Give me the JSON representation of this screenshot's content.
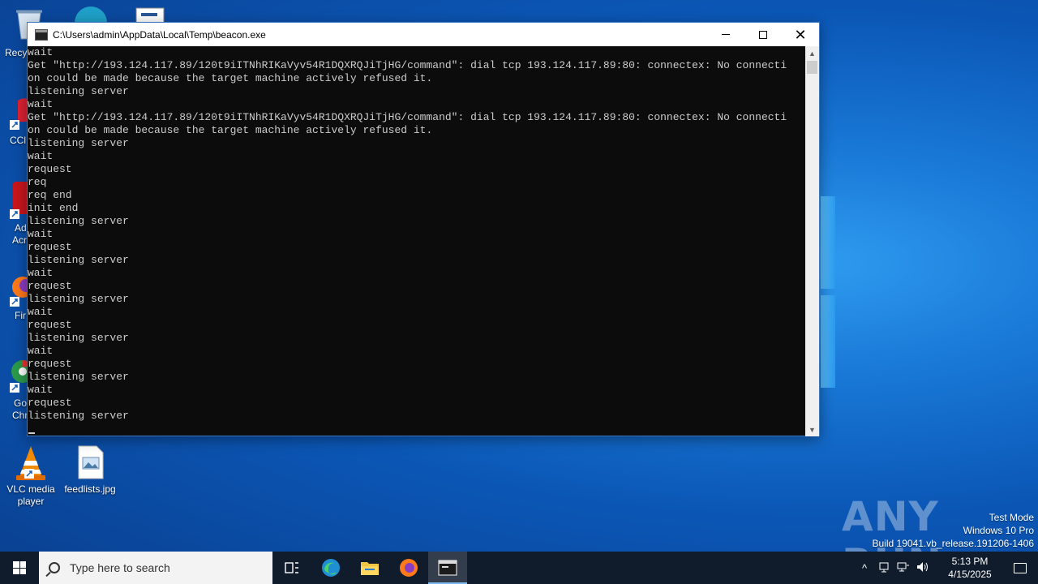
{
  "desktop": {
    "icons": [
      {
        "label": "Recy"
      },
      {
        "label": "CCl"
      },
      {
        "label": "Ad"
      },
      {
        "label": "Acr"
      },
      {
        "label": "Fir"
      },
      {
        "label": "Go"
      },
      {
        "label": "Chr"
      }
    ],
    "vlc_label": "VLC media player",
    "feedlists_label": "feedlists.jpg"
  },
  "console": {
    "title": "C:\\Users\\admin\\AppData\\Local\\Temp\\beacon.exe",
    "lines": [
      "wait",
      "Get \"http://193.124.117.89/120t9iITNhRIKaVyv54R1DQXRQJiTjHG/command\": dial tcp 193.124.117.89:80: connectex: No connecti",
      "on could be made because the target machine actively refused it.",
      "listening server",
      "wait",
      "Get \"http://193.124.117.89/120t9iITNhRIKaVyv54R1DQXRQJiTjHG/command\": dial tcp 193.124.117.89:80: connectex: No connecti",
      "on could be made because the target machine actively refused it.",
      "listening server",
      "wait",
      "request",
      "req",
      "req end",
      "init end",
      "listening server",
      "wait",
      "request",
      "listening server",
      "wait",
      "request",
      "listening server",
      "wait",
      "request",
      "listening server",
      "wait",
      "request",
      "listening server",
      "wait",
      "request",
      "listening server"
    ]
  },
  "watermark": {
    "brand": "ANY RUN",
    "test_mode": "Test Mode",
    "edition": "Windows 10 Pro",
    "build": "Build 19041.vb_release.191206-1406"
  },
  "taskbar": {
    "search_placeholder": "Type here to search",
    "time": "5:13 PM",
    "date": "4/15/2025"
  }
}
